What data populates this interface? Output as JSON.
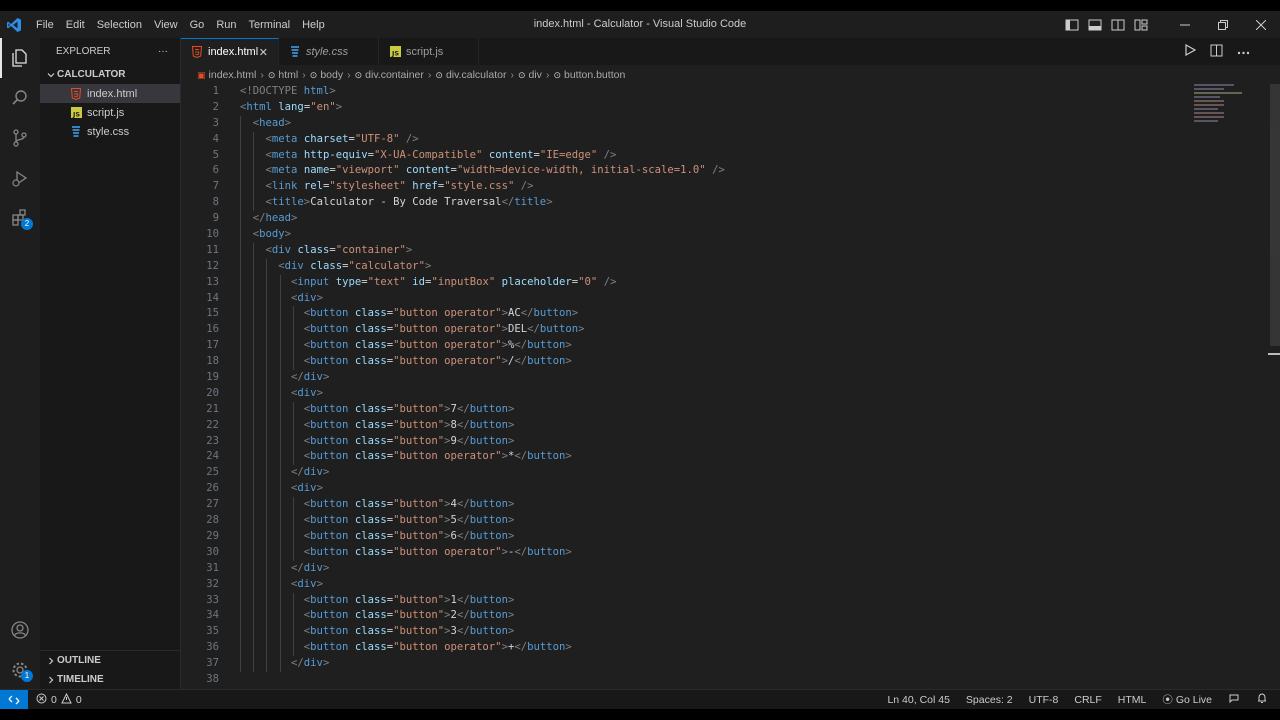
{
  "window": {
    "title": "index.html - Calculator - Visual Studio Code"
  },
  "menu": [
    "File",
    "Edit",
    "Selection",
    "View",
    "Go",
    "Run",
    "Terminal",
    "Help"
  ],
  "explorer": {
    "header": "EXPLORER",
    "more": "···",
    "project": "CALCULATOR",
    "files": [
      {
        "name": "index.html",
        "icon": "html-file-icon"
      },
      {
        "name": "script.js",
        "icon": "js-file-icon"
      },
      {
        "name": "style.css",
        "icon": "css-file-icon"
      }
    ],
    "outline": "OUTLINE",
    "timeline": "TIMELINE"
  },
  "tabs": [
    {
      "label": "index.html",
      "icon": "html-file-icon"
    },
    {
      "label": "style.css",
      "icon": "css-file-icon"
    },
    {
      "label": "script.js",
      "icon": "js-file-icon"
    }
  ],
  "breadcrumb": [
    "index.html",
    "html",
    "body",
    "div.container",
    "div.calculator",
    "div",
    "button.button"
  ],
  "badges": {
    "extensions": "2",
    "settings": "1"
  },
  "status": {
    "errors": "0",
    "warnings": "0",
    "position": "Ln 40, Col 45",
    "spaces": "Spaces: 2",
    "encoding": "UTF-8",
    "eol": "CRLF",
    "language": "HTML",
    "golive": "Go Live"
  },
  "code_lines": [
    "<!DOCTYPE html>",
    "<html lang=\"en\">",
    "  <head>",
    "    <meta charset=\"UTF-8\" />",
    "    <meta http-equiv=\"X-UA-Compatible\" content=\"IE=edge\" />",
    "    <meta name=\"viewport\" content=\"width=device-width, initial-scale=1.0\" />",
    "    <link rel=\"stylesheet\" href=\"style.css\" />",
    "    <title>Calculator - By Code Traversal</title>",
    "  </head>",
    "  <body>",
    "    <div class=\"container\">",
    "      <div class=\"calculator\">",
    "        <input type=\"text\" id=\"inputBox\" placeholder=\"0\" />",
    "        <div>",
    "          <button class=\"button operator\">AC</button>",
    "          <button class=\"button operator\">DEL</button>",
    "          <button class=\"button operator\">%</button>",
    "          <button class=\"button operator\">/</button>",
    "        </div>",
    "        <div>",
    "          <button class=\"button\">7</button>",
    "          <button class=\"button\">8</button>",
    "          <button class=\"button\">9</button>",
    "          <button class=\"button operator\">*</button>",
    "        </div>",
    "        <div>",
    "          <button class=\"button\">4</button>",
    "          <button class=\"button\">5</button>",
    "          <button class=\"button\">6</button>",
    "          <button class=\"button operator\">-</button>",
    "        </div>",
    "        <div>",
    "          <button class=\"button\">1</button>",
    "          <button class=\"button\">2</button>",
    "          <button class=\"button\">3</button>",
    "          <button class=\"button operator\">+</button>",
    "        </div>",
    ""
  ],
  "colors": {
    "accent": "#0078d4",
    "tag": "#569cd6",
    "attr": "#9cdcfe",
    "string": "#ce9178",
    "html_icon": "#e44d26",
    "css_icon": "#42a5f5",
    "js_icon": "#cbcb41"
  }
}
